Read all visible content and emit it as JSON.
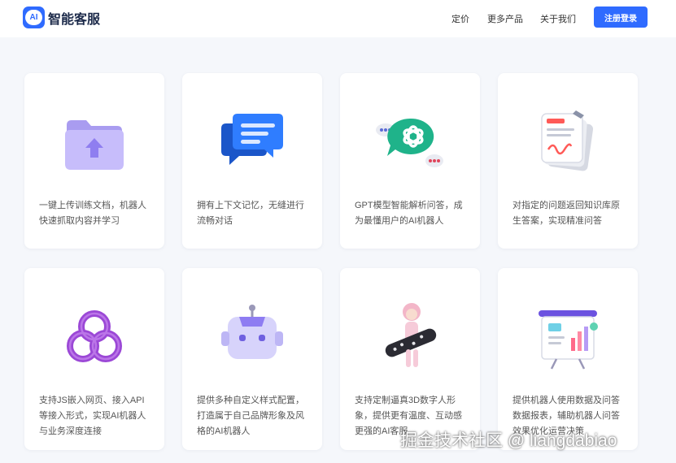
{
  "brand": {
    "badge": "AI",
    "name": "智能客服"
  },
  "nav": {
    "pricing": "定价",
    "more_products": "更多产品",
    "about": "关于我们",
    "register": "注册登录"
  },
  "features": [
    {
      "icon": "folder-upload-icon",
      "text": "一键上传训练文档，机器人快速抓取内容并学习"
    },
    {
      "icon": "chat-bubble-icon",
      "text": "拥有上下文记忆，无缝进行流畅对话"
    },
    {
      "icon": "openai-logo-icon",
      "text": "GPT模型智能解析问答，成为最懂用户的AI机器人"
    },
    {
      "icon": "document-stack-icon",
      "text": "对指定的问题返回知识库原生答案，实现精准问答"
    },
    {
      "icon": "knot-icon",
      "text": "支持JS嵌入网页、接入API等接入形式，实现AI机器人与业务深度连接"
    },
    {
      "icon": "robot-icon",
      "text": "提供多种自定义样式配置，打造属于自己品牌形象及风格的AI机器人"
    },
    {
      "icon": "avatar-figure-icon",
      "text": "支持定制逼真3D数字人形象，提供更有温度、互动感更强的AI客服"
    },
    {
      "icon": "data-board-icon",
      "text": "提供机器人使用数据及问答数据报表，辅助机器人问答效果优化运营决策"
    }
  ],
  "watermark": "掘金技术社区 @ liangdabiao",
  "colors": {
    "accent": "#2f6bff",
    "page_bg": "#f5f7fb",
    "card_bg": "#ffffff"
  }
}
